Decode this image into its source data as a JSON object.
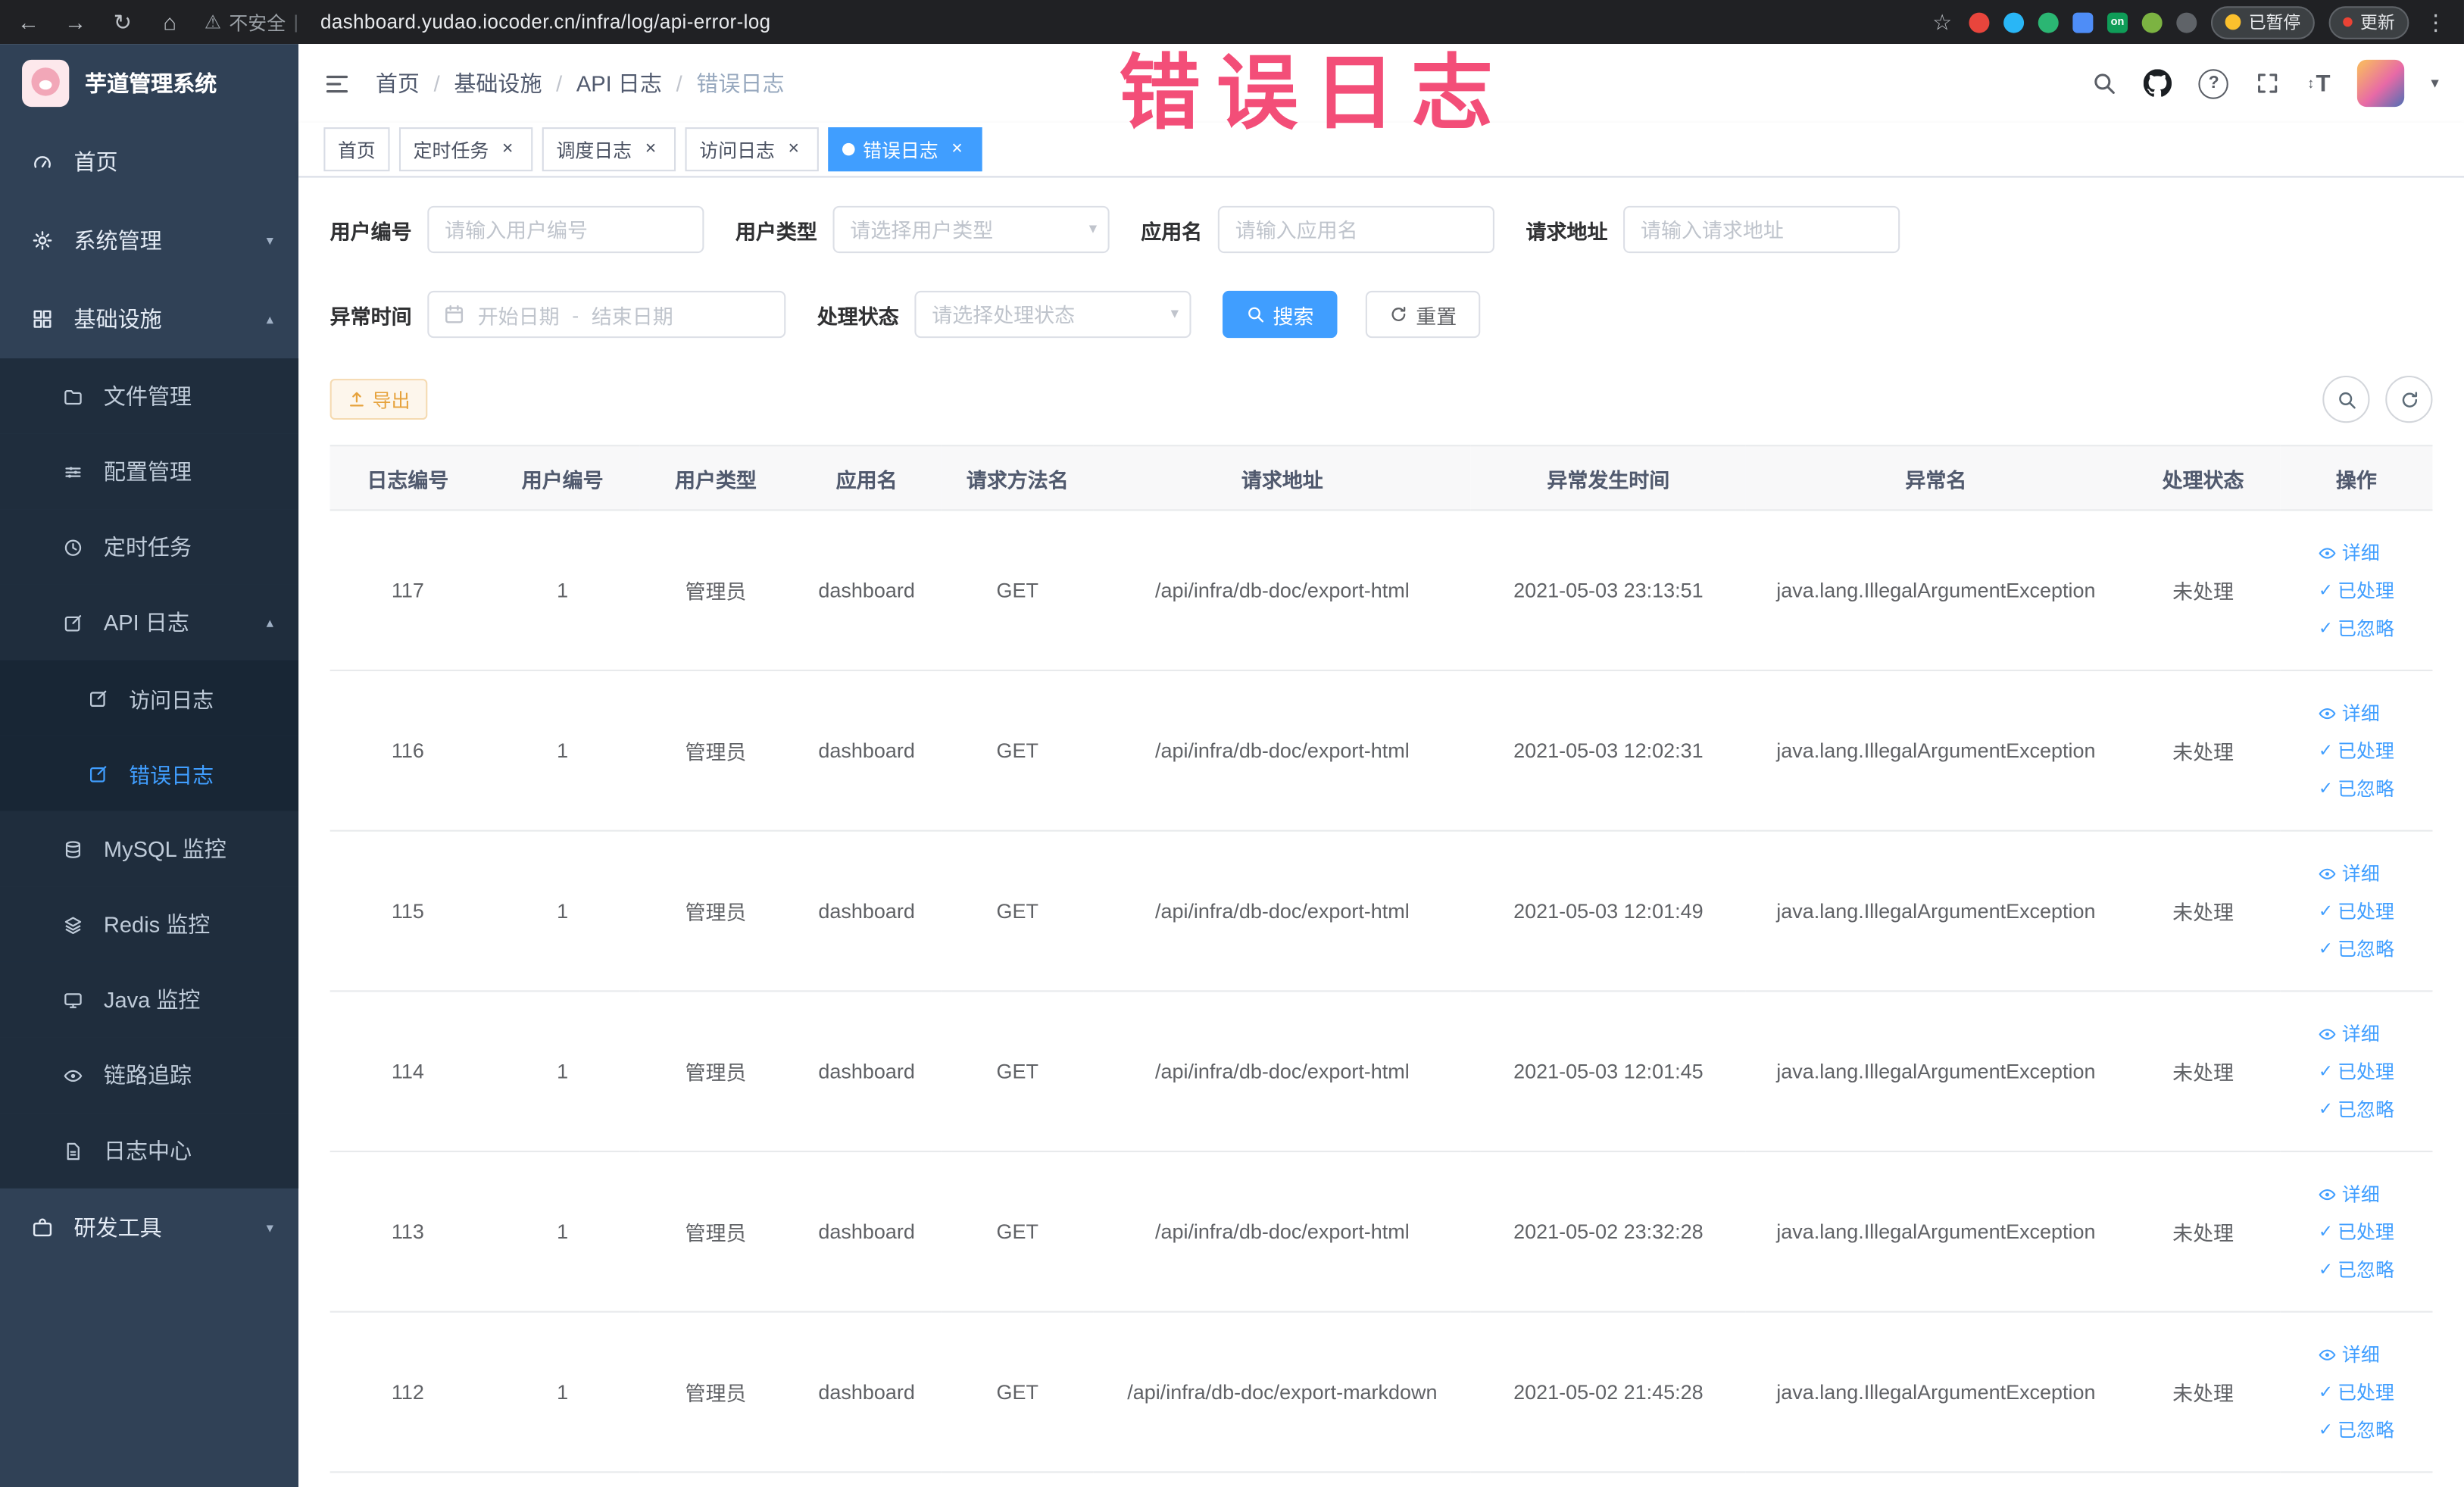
{
  "ui": {
    "icons": {
      "back": "←",
      "forward": "→",
      "reload": "↻",
      "home": "⌂",
      "warning": "⚠",
      "star": "☆",
      "kebab": "⋮",
      "pipe": "|",
      "close": "×",
      "caret_down": "▾",
      "caret_up": "▴",
      "check": "✓",
      "updown": "↕",
      "question": "?"
    },
    "colors": {
      "accent": "#409eff",
      "warning": "#e6a23c",
      "stamp": "#f23f6d",
      "sidebar_bg": "#304156",
      "submenu_bg": "#1f2d3d"
    }
  },
  "browser": {
    "security_label": "不安全",
    "url": "dashboard.yudao.iocoder.cn/infra/log/api-error-log",
    "extension_on_badge": "on",
    "paused_badge": "已暂停",
    "update_button": "更新"
  },
  "annotation": {
    "stamp": "错误日志"
  },
  "sidebar": {
    "logo_title": "芋道管理系统",
    "items": [
      {
        "label": "首页"
      },
      {
        "label": "系统管理"
      },
      {
        "label": "基础设施"
      },
      {
        "label": "文件管理"
      },
      {
        "label": "配置管理"
      },
      {
        "label": "定时任务"
      },
      {
        "label": "API 日志"
      },
      {
        "label": "访问日志"
      },
      {
        "label": "错误日志"
      },
      {
        "label": "MySQL 监控"
      },
      {
        "label": "Redis 监控"
      },
      {
        "label": "Java 监控"
      },
      {
        "label": "链路追踪"
      },
      {
        "label": "日志中心"
      },
      {
        "label": "研发工具"
      }
    ]
  },
  "header": {
    "breadcrumb": [
      "首页",
      "基础设施",
      "API 日志",
      "错误日志"
    ],
    "separator": "/"
  },
  "tabs": [
    {
      "label": "首页"
    },
    {
      "label": "定时任务"
    },
    {
      "label": "调度日志"
    },
    {
      "label": "访问日志"
    },
    {
      "label": "错误日志"
    }
  ],
  "filters": {
    "user_id_label": "用户编号",
    "user_id_placeholder": "请输入用户编号",
    "user_type_label": "用户类型",
    "user_type_placeholder": "请选择用户类型",
    "app_name_label": "应用名",
    "app_name_placeholder": "请输入应用名",
    "request_url_label": "请求地址",
    "request_url_placeholder": "请输入请求地址",
    "exception_time_label": "异常时间",
    "start_date_placeholder": "开始日期",
    "range_separator": "-",
    "end_date_placeholder": "结束日期",
    "process_status_label": "处理状态",
    "process_status_placeholder": "请选择处理状态",
    "search_button": "搜索",
    "reset_button": "重置"
  },
  "toolbar": {
    "export_button": "导出"
  },
  "table": {
    "headers": [
      "日志编号",
      "用户编号",
      "用户类型",
      "应用名",
      "请求方法名",
      "请求地址",
      "异常发生时间",
      "异常名",
      "处理状态",
      "操作"
    ],
    "actions": {
      "detail": "详细",
      "processed": "已处理",
      "ignored": "已忽略"
    },
    "rows": [
      {
        "id": "117",
        "user_id": "1",
        "user_type": "管理员",
        "app": "dashboard",
        "method": "GET",
        "url": "/api/infra/db-doc/export-html",
        "time": "2021-05-03 23:13:51",
        "exception": "java.lang.IllegalArgumentException",
        "status": "未处理"
      },
      {
        "id": "116",
        "user_id": "1",
        "user_type": "管理员",
        "app": "dashboard",
        "method": "GET",
        "url": "/api/infra/db-doc/export-html",
        "time": "2021-05-03 12:02:31",
        "exception": "java.lang.IllegalArgumentException",
        "status": "未处理"
      },
      {
        "id": "115",
        "user_id": "1",
        "user_type": "管理员",
        "app": "dashboard",
        "method": "GET",
        "url": "/api/infra/db-doc/export-html",
        "time": "2021-05-03 12:01:49",
        "exception": "java.lang.IllegalArgumentException",
        "status": "未处理"
      },
      {
        "id": "114",
        "user_id": "1",
        "user_type": "管理员",
        "app": "dashboard",
        "method": "GET",
        "url": "/api/infra/db-doc/export-html",
        "time": "2021-05-03 12:01:45",
        "exception": "java.lang.IllegalArgumentException",
        "status": "未处理"
      },
      {
        "id": "113",
        "user_id": "1",
        "user_type": "管理员",
        "app": "dashboard",
        "method": "GET",
        "url": "/api/infra/db-doc/export-html",
        "time": "2021-05-02 23:32:28",
        "exception": "java.lang.IllegalArgumentException",
        "status": "未处理"
      },
      {
        "id": "112",
        "user_id": "1",
        "user_type": "管理员",
        "app": "dashboard",
        "method": "GET",
        "url": "/api/infra/db-doc/export-markdown",
        "time": "2021-05-02 21:45:28",
        "exception": "java.lang.IllegalArgumentException",
        "status": "未处理"
      }
    ]
  }
}
